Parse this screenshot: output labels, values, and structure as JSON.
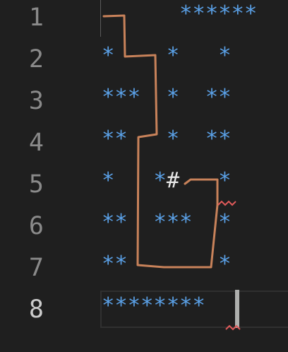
{
  "editor": {
    "lines": [
      {
        "number": "1",
        "text": "      ******"
      },
      {
        "number": "2",
        "text": "*    *   *"
      },
      {
        "number": "3",
        "text": "***  *  **"
      },
      {
        "number": "4",
        "text": "**   *  **"
      },
      {
        "number": "5",
        "text_before": "*   *",
        "hash": "#",
        "text_after": "   *"
      },
      {
        "number": "6",
        "text": "**  ***  *"
      },
      {
        "number": "7",
        "text": "**       *"
      },
      {
        "number": "8",
        "text": "********"
      }
    ],
    "active_line": "8"
  },
  "colors": {
    "background": "#1f1f1f",
    "asterisk": "#5aa0e6",
    "line_number": "#8a8a8a",
    "line_number_active": "#cccccc",
    "path_stroke": "#c8825a",
    "squiggle": "#e05a5a"
  }
}
